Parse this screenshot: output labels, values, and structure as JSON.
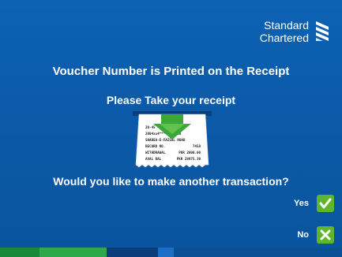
{
  "brand": {
    "line1": "Standard",
    "line2": "Chartered"
  },
  "heading": "Voucher Number is Printed on the Receipt",
  "subheading": "Please Take  your receipt",
  "receipt_lines": [
    [
      "20-45",
      ""
    ],
    [
      "2004xx4*********16",
      ""
    ],
    [
      "SHAREA-E-FAISAL ROAD",
      ""
    ],
    [
      "RECORD NO.",
      "7458"
    ],
    [
      "WITHDRAWAL",
      "PKR 2000.00"
    ],
    [
      "AVAL BAL",
      "PKR 28975.30"
    ]
  ],
  "question": "Would you like to make another transaction?",
  "options": {
    "yes_label": "Yes",
    "no_label": "No"
  },
  "colors": {
    "background": "#0b5aa8",
    "accent_green": "#5fb62e",
    "bar": [
      "#1a8a3a",
      "#2ea84a",
      "#0a3d7a",
      "#1c6fc4",
      "#0b4f95"
    ]
  }
}
